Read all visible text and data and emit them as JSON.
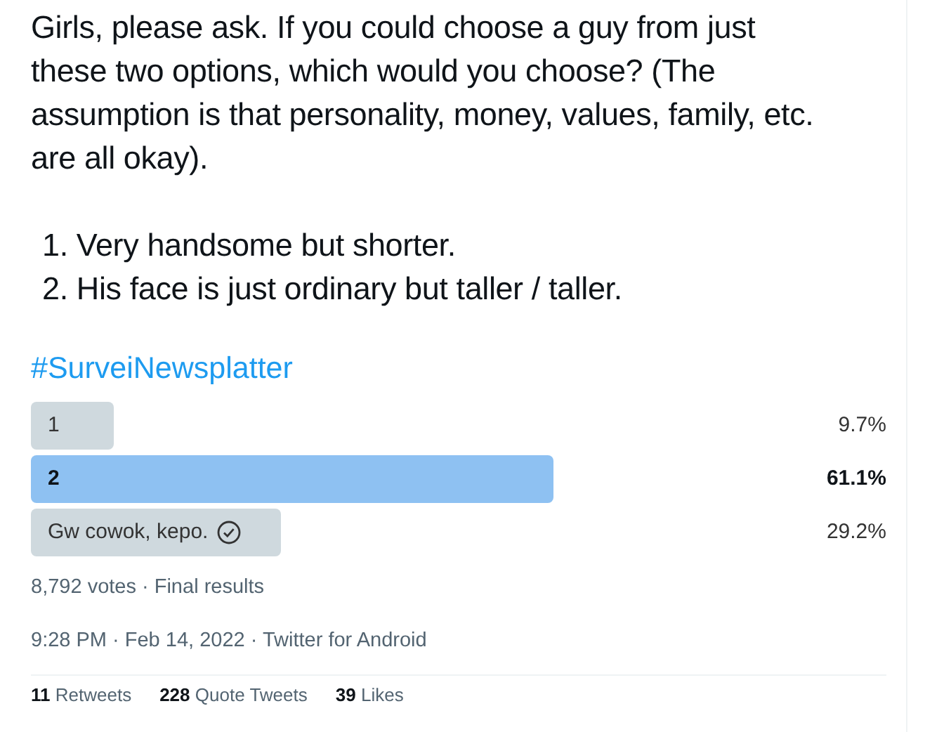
{
  "tweet": {
    "paragraphs": [
      "Girls, please ask. If you could choose a guy from just these two options, which would you choose? (The assumption is that personality, money, values, family, etc. are all okay)."
    ],
    "list": [
      "1. Very handsome but shorter.",
      "2. His face is just ordinary but taller / taller."
    ],
    "hashtag": "#SurveiNewsplatter",
    "poll": {
      "options": [
        {
          "label": "1",
          "percent": "9.7%",
          "level": 0.097,
          "winner": false,
          "voted": false
        },
        {
          "label": "2",
          "percent": "61.1%",
          "level": 0.611,
          "winner": true,
          "voted": false
        },
        {
          "label": "Gw cowok, kepo.",
          "percent": "29.2%",
          "level": 0.292,
          "winner": false,
          "voted": true
        }
      ],
      "summary": "8,792 votes · Final results"
    },
    "timestamp": "9:28 PM · Feb 14, 2022 · Twitter for Android",
    "stats": [
      {
        "count": "11",
        "label": "Retweets"
      },
      {
        "count": "228",
        "label": "Quote Tweets"
      },
      {
        "count": "39",
        "label": "Likes"
      }
    ]
  }
}
